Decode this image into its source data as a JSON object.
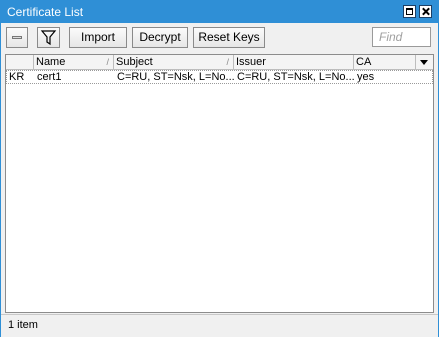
{
  "window": {
    "title": "Certificate List"
  },
  "toolbar": {
    "import_label": "Import",
    "decrypt_label": "Decrypt",
    "reset_keys_label": "Reset Keys",
    "find_placeholder": "Find",
    "remove_icon": "minus-icon",
    "filter_icon": "filter-icon"
  },
  "table": {
    "columns": [
      "Name",
      "Subject",
      "Issuer",
      "CA"
    ],
    "rows": [
      {
        "flags": "KR",
        "name": "cert1",
        "subject": "C=RU, ST=Nsk, L=No...",
        "issuer": "C=RU, ST=Nsk, L=No...",
        "ca": "yes"
      }
    ]
  },
  "status": {
    "text": "1 item"
  },
  "colors": {
    "titlebar": "#2f8fd6"
  }
}
